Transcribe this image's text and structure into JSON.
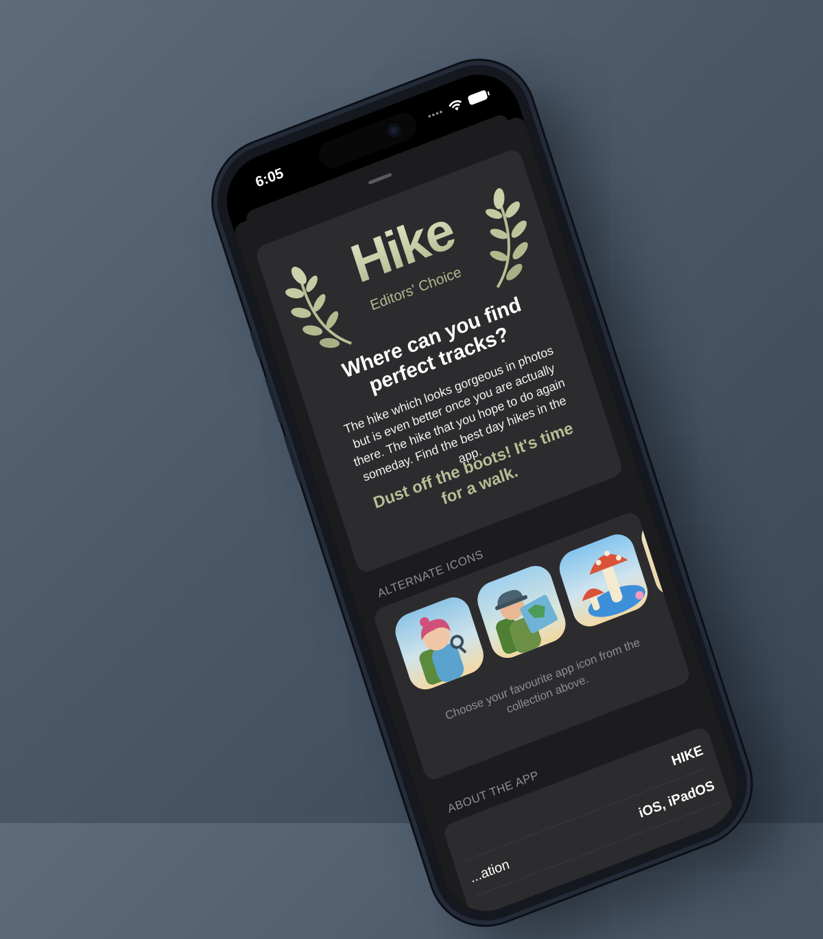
{
  "status_bar": {
    "time": "6:05",
    "signal_indicator": "••••",
    "icons": [
      "wifi-icon",
      "battery-icon"
    ]
  },
  "hero": {
    "logo_title": "Hike",
    "logo_subtitle": "Editors' Choice",
    "headline": "Where can you find perfect tracks?",
    "body": "The hike which looks gorgeous in photos but is even better once you are actually there. The hike that you hope to do again someday. Find the best day hikes in the app.",
    "call_to_action": "Dust off the boots! It's time for a walk."
  },
  "alternate_icons": {
    "section_title": "ALTERNATE ICONS",
    "icons": [
      "hiker-girl-icon",
      "hiker-boy-map-icon",
      "mushroom-icon",
      "camera-icon"
    ],
    "caption": "Choose your favourite app icon from the collection above."
  },
  "about": {
    "section_title": "ABOUT THE APP",
    "rows": [
      {
        "label": "",
        "value": "HIKE"
      },
      {
        "label": "...ation",
        "value": "iOS, iPadOS"
      }
    ]
  },
  "colors": {
    "accent": "#b6be95",
    "background": "#1c1c1e",
    "card": "#2c2c2e"
  }
}
